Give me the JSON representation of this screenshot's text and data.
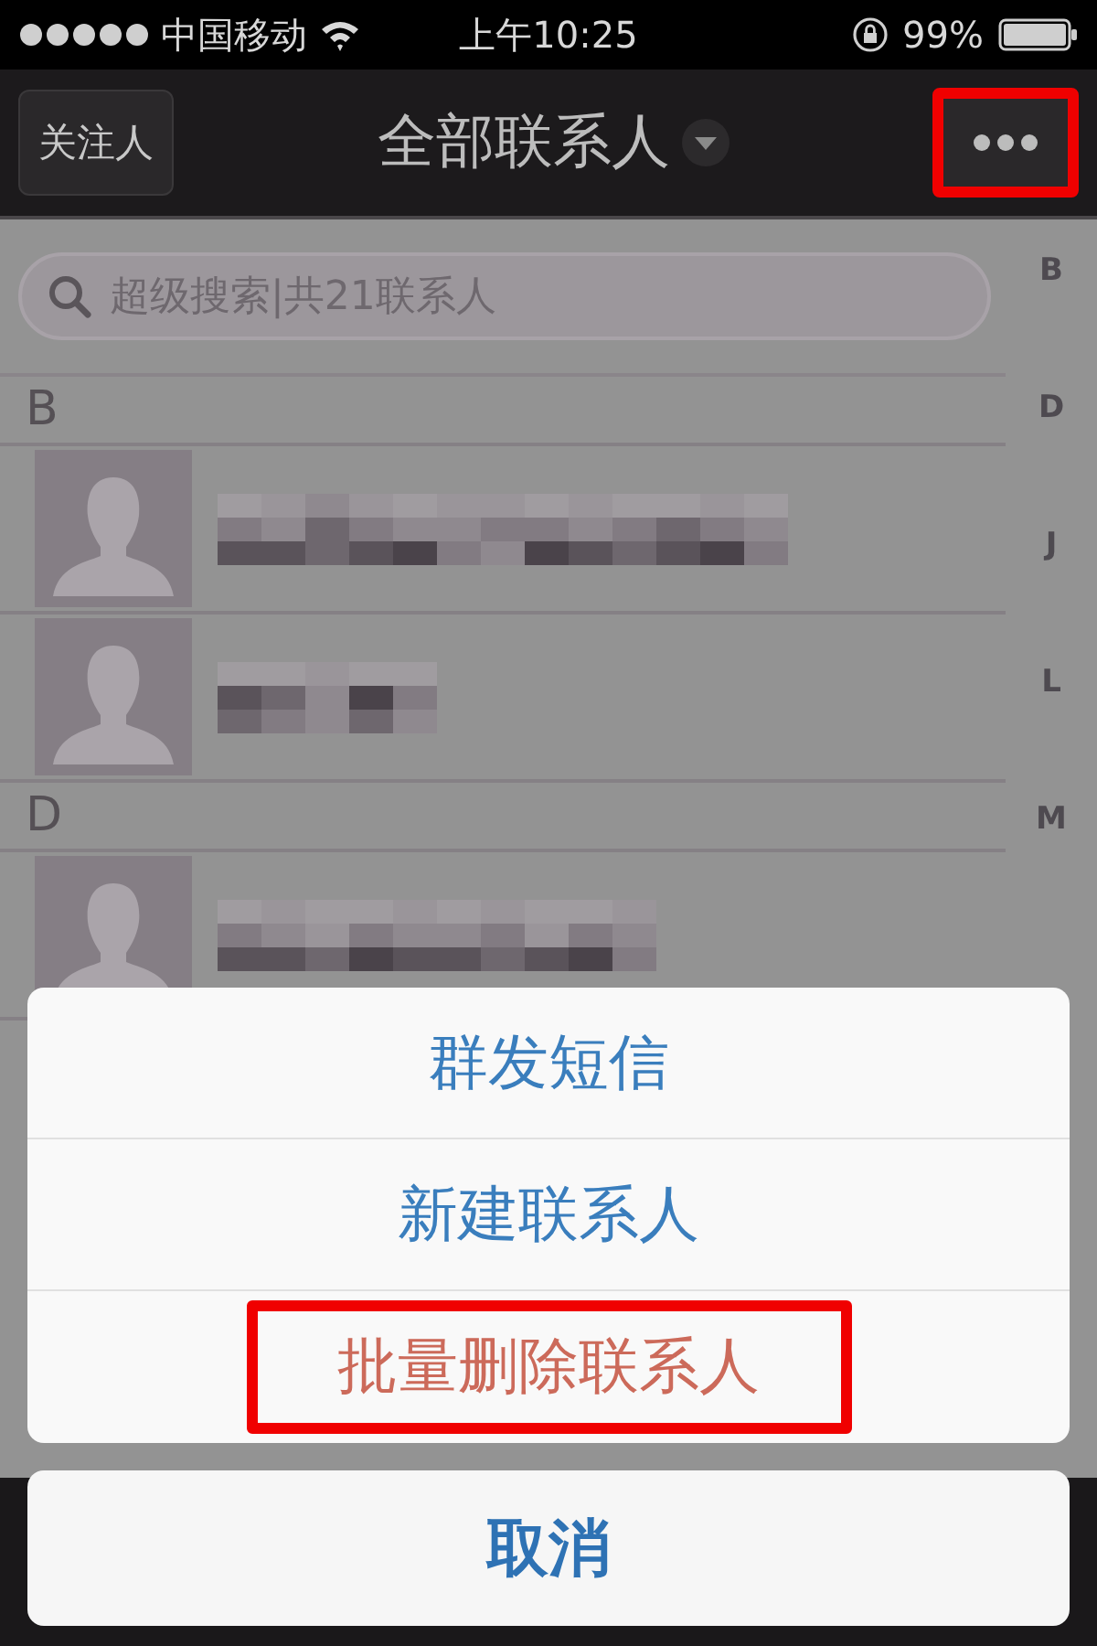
{
  "status_bar": {
    "carrier": "中国移动",
    "time": "上午10:25",
    "battery": "99%"
  },
  "nav": {
    "left_button": "关注人",
    "title": "全部联系人",
    "more_highlighted": true
  },
  "search": {
    "placeholder": "超级搜索|共21联系人"
  },
  "index_letters": [
    "B",
    "D",
    "J",
    "L",
    "M"
  ],
  "sections": [
    {
      "letter": "B",
      "rows": [
        {
          "kind": "blurred"
        },
        {
          "kind": "blurred"
        }
      ]
    },
    {
      "letter": "D",
      "rows": [
        {
          "kind": "blurred"
        }
      ]
    }
  ],
  "action_sheet": {
    "items": [
      {
        "label": "群发短信",
        "kind": "normal",
        "highlighted": false
      },
      {
        "label": "新建联系人",
        "kind": "normal",
        "highlighted": false
      },
      {
        "label": "批量删除联系人",
        "kind": "destructive",
        "highlighted": true
      }
    ],
    "cancel": "取消"
  }
}
